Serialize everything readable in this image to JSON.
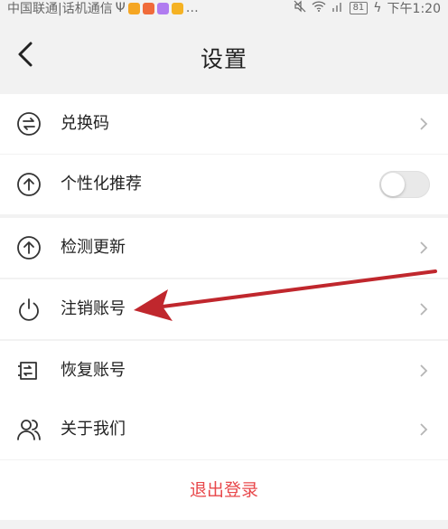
{
  "status_bar": {
    "carrier": "中国联通|话机通信",
    "extra": "…",
    "battery": "81",
    "time": "下午1:20",
    "app_badge_colors": [
      "#f5a623",
      "#f06b3a",
      "#b07cf0",
      "#f5b223"
    ]
  },
  "header": {
    "title": "设置",
    "back_icon": "chevron-left-icon"
  },
  "settings": [
    {
      "label": "兑换码",
      "icon": "exchange-icon",
      "control": "chevron"
    },
    {
      "label": "个性化推荐",
      "icon": "arrow-up-circle-icon",
      "control": "toggle",
      "toggle_on": false
    },
    {
      "label": "检测更新",
      "icon": "arrow-up-circle-icon",
      "control": "chevron"
    },
    {
      "label": "注销账号",
      "icon": "power-icon",
      "control": "chevron"
    },
    {
      "label": "恢复账号",
      "icon": "restore-account-icon",
      "control": "chevron"
    },
    {
      "label": "关于我们",
      "icon": "users-icon",
      "control": "chevron"
    }
  ],
  "logout": {
    "label": "退出登录",
    "color": "#e8484b"
  },
  "annotation": {
    "color": "#c0272d",
    "target": "注销账号"
  }
}
